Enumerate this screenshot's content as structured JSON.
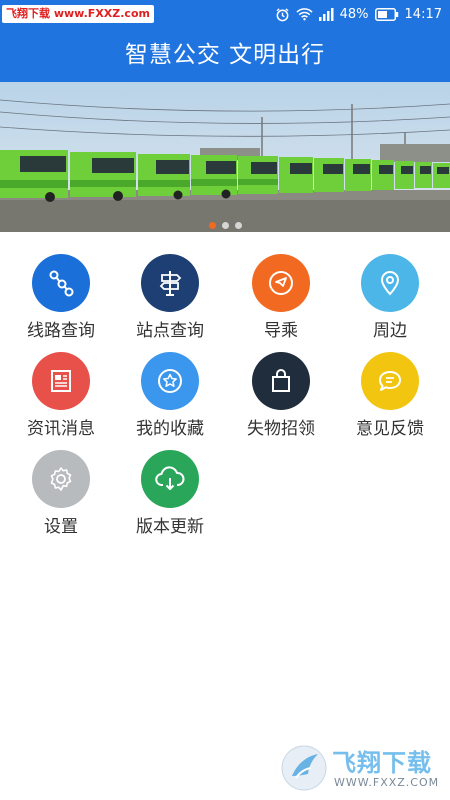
{
  "status_bar": {
    "watermark_left": "飞翔下载",
    "watermark_url": "www.FXXZ.com",
    "battery": "48%",
    "time": "14:17"
  },
  "header": {
    "title": "智慧公交 文明出行"
  },
  "menu": [
    {
      "label": "线路查询",
      "icon": "route-icon",
      "color": "#1a6fd8"
    },
    {
      "label": "站点查询",
      "icon": "signpost-icon",
      "color": "#1d3f73"
    },
    {
      "label": "导乘",
      "icon": "compass-icon",
      "color": "#f26a22"
    },
    {
      "label": "周边",
      "icon": "location-pin-icon",
      "color": "#4db6e8"
    },
    {
      "label": "资讯消息",
      "icon": "news-icon",
      "color": "#e8514a"
    },
    {
      "label": "我的收藏",
      "icon": "star-icon",
      "color": "#3b97ee"
    },
    {
      "label": "失物招领",
      "icon": "bag-icon",
      "color": "#1f2d3d"
    },
    {
      "label": "意见反馈",
      "icon": "chat-icon",
      "color": "#f2c511"
    },
    {
      "label": "设置",
      "icon": "gear-icon",
      "color": "#b8bbbe"
    },
    {
      "label": "版本更新",
      "icon": "cloud-download-icon",
      "color": "#2aa65b"
    }
  ],
  "bottom_watermark": {
    "brand": "飞翔下载",
    "url": "WWW.FXXZ.COM"
  }
}
